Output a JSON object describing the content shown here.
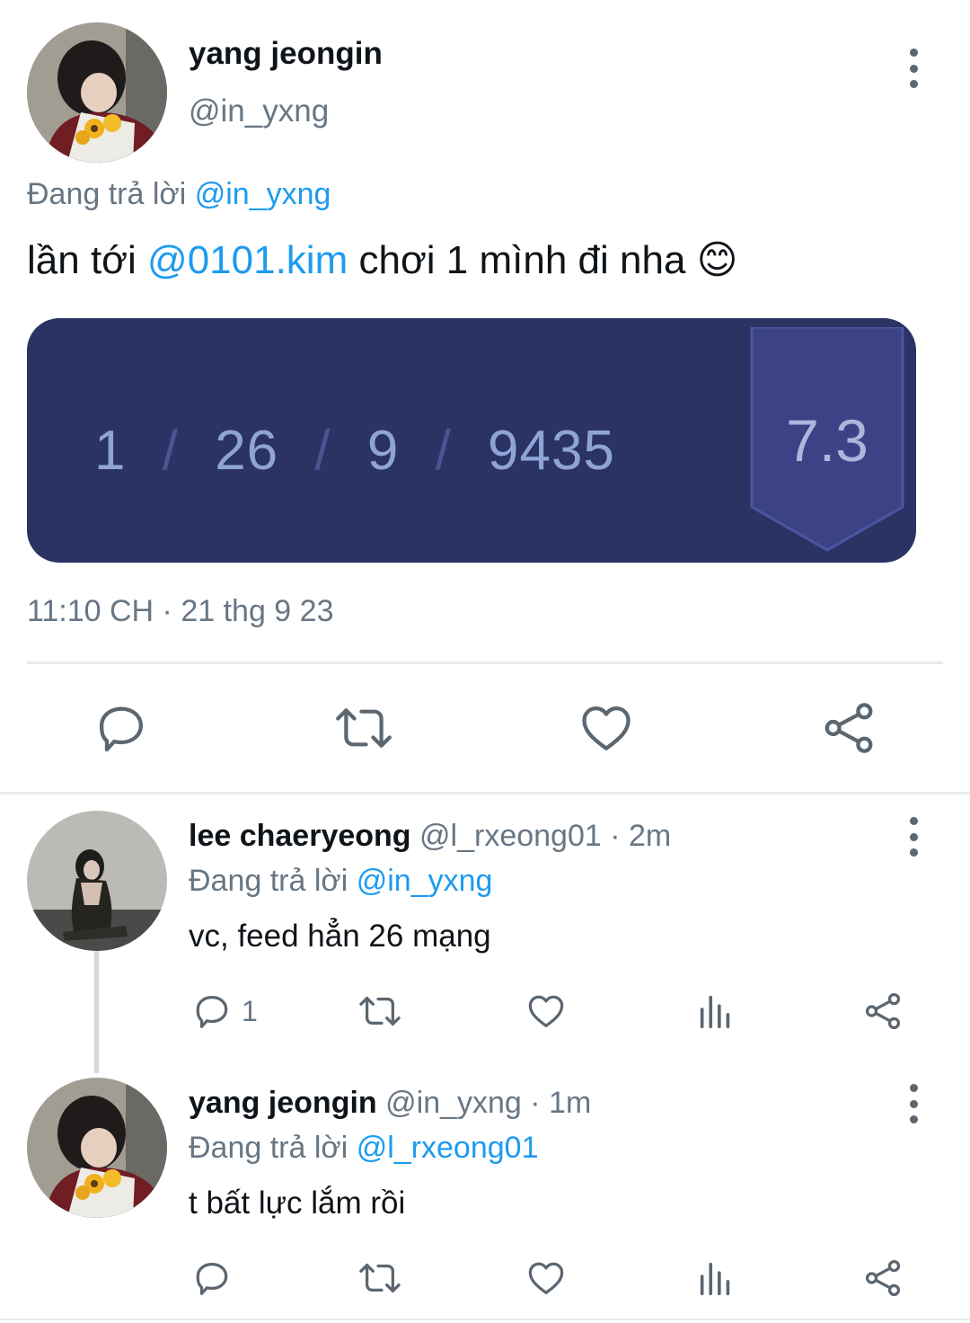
{
  "main_tweet": {
    "author_name": "yang jeongin",
    "handle": "@in_yxng",
    "replying_prefix": "Đang trả lời",
    "replying_to": "@in_yxng",
    "text_before": "lần tới",
    "mention": "@0101.kim",
    "text_after": "chơi 1 mình đi nha",
    "emoji": "😊",
    "timestamp": "11:10 CH · 21 thg 9 23",
    "stats_image": {
      "kills": "1",
      "deaths": "26",
      "assists": "9",
      "gold": "9435",
      "sep": "/",
      "score": "7.3"
    }
  },
  "replies": [
    {
      "author_name": "lee chaeryeong",
      "handle_time": "@l_rxeong01 · 2m",
      "replying_prefix": "Đang trả lời",
      "replying_to": "@in_yxng",
      "text": "vc, feed hẳn 26 mạng",
      "reply_count": "1"
    },
    {
      "author_name": "yang jeongin",
      "handle_time": "@in_yxng · 1m",
      "replying_prefix": "Đang trả lời",
      "replying_to": "@l_rxeong01",
      "text": "t bất lực lắm rồi",
      "reply_count": ""
    }
  ],
  "icons": {
    "reply": "speech-bubble-icon",
    "retweet": "retweet-icon",
    "like": "heart-icon",
    "share": "share-icon",
    "views": "bar-chart-icon",
    "more": "kebab-icon"
  },
  "colors": {
    "link": "#1d9bf0",
    "muted": "#687684",
    "icon": "#5b6670",
    "rank_bg": "#2b3264"
  }
}
